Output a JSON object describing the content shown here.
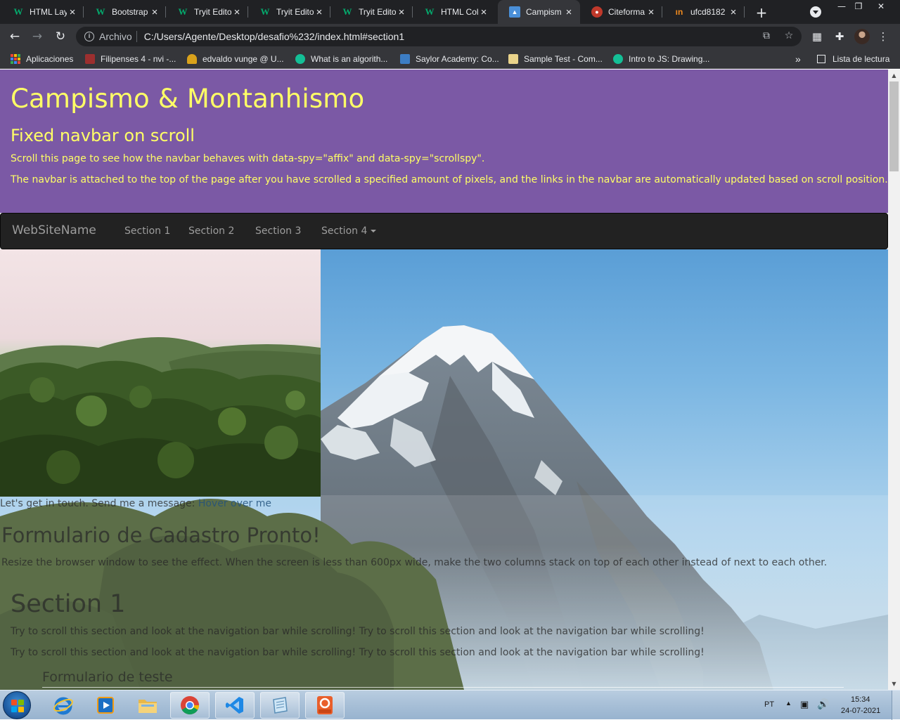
{
  "browser": {
    "tabs": [
      {
        "title": "HTML Lay",
        "favicon": "w3schools-icon",
        "active": false
      },
      {
        "title": "Bootstrap",
        "favicon": "w3schools-icon",
        "active": false
      },
      {
        "title": "Tryit Edito",
        "favicon": "w3schools-icon",
        "active": false
      },
      {
        "title": "Tryit Edito",
        "favicon": "w3schools-icon",
        "active": false
      },
      {
        "title": "Tryit Edito",
        "favicon": "w3schools-icon",
        "active": false
      },
      {
        "title": "HTML Col",
        "favicon": "w3schools-icon",
        "active": false
      },
      {
        "title": "Campism",
        "favicon": "campismo-icon",
        "active": true
      },
      {
        "title": "Citeforma",
        "favicon": "citeforma-icon",
        "active": false
      },
      {
        "title": "ufcd8182",
        "favicon": "ufcd-icon",
        "active": false
      }
    ],
    "address": {
      "scheme_label": "Archivo",
      "url": "C:/Users/Agente/Desktop/desafio%232/index.html#section1"
    },
    "bookmarks": [
      {
        "label": "Aplicaciones"
      },
      {
        "label": "Filipenses 4 - nvi -..."
      },
      {
        "label": "edvaldo vunge @ U..."
      },
      {
        "label": "What is an algorith..."
      },
      {
        "label": "Saylor Academy: Co..."
      },
      {
        "label": "Sample Test - Com..."
      },
      {
        "label": "Intro to JS: Drawing..."
      }
    ],
    "overflow_label": "»",
    "reading_list_label": "Lista de lectura"
  },
  "page": {
    "jumbotron": {
      "title": "Campismo & Montanhismo",
      "subtitle": "Fixed navbar on scroll",
      "line1": "Scroll this page to see how the navbar behaves with data-spy=\"affix\" and data-spy=\"scrollspy\".",
      "line2": "The navbar is attached to the top of the page after you have scrolled a specified amount of pixels, and the links in the navbar are automatically updated based on scroll position."
    },
    "navbar": {
      "brand": "WebSiteName",
      "links": [
        "Section 1",
        "Section 2",
        "Section 3",
        "Section 4"
      ]
    },
    "contact_text": "Let's get in touch. Send me a message:",
    "contact_link": "Hover over me",
    "form_heading": "Formulario de Cadastro Pronto!",
    "resize_text": "Resize the browser window to see the effect. When the screen is less than 600px wide, make the two columns stack on top of each other instead of next to each other.",
    "section1_heading": "Section 1",
    "section1_p1a": "Try to scroll this section and look at the navigation bar while scrolling!",
    "section1_p1b": "Try to scroll this section and look at the navigation bar while scrolling!",
    "section1_p2a": "Try to scroll this section and look at the navigation bar while scrolling!",
    "section1_p2b": "Try to scroll this section and look at the navigation bar while scrolling!",
    "subheading": "Formulario de teste",
    "colors": {
      "jumbotron_bg": "#7b59a5",
      "jumbotron_text": "#ffff66",
      "navbar_bg": "#222222",
      "navbar_text": "#9d9d9d"
    }
  },
  "taskbar": {
    "apps": [
      "internet-explorer-icon",
      "media-player-icon",
      "file-explorer-icon",
      "chrome-icon",
      "vscode-icon",
      "notepad-icon",
      "pdf-icon"
    ],
    "language": "PT",
    "time": "15:34",
    "date": "24-07-2021"
  }
}
